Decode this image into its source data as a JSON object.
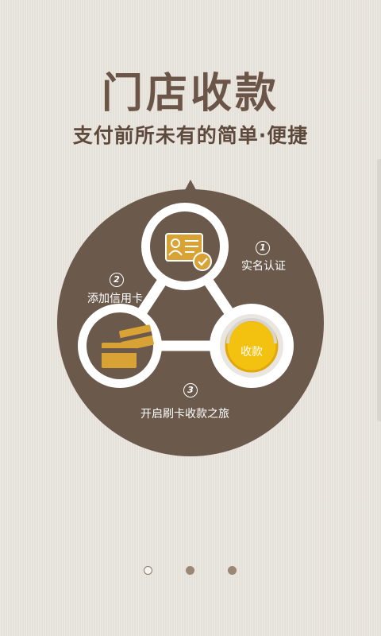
{
  "header": {
    "title": "门店收款",
    "subtitle": "支付前所未有的简单·便捷"
  },
  "steps": [
    {
      "number": "1",
      "label": "实名认证",
      "icon": "id-card-icon"
    },
    {
      "number": "2",
      "label": "添加信用卡",
      "icon": "credit-cards-icon"
    },
    {
      "number": "3",
      "label": "开启刷卡收款之旅",
      "icon": "payment-coin-icon"
    }
  ],
  "pay_button": {
    "label": "收款"
  },
  "pager": {
    "total": 3,
    "current": 1
  },
  "colors": {
    "background": "#e8e4dc",
    "bubble": "#6b5a4c",
    "title": "#6a5548",
    "gold": "#d9a235",
    "pay_yellow": "#f3c10f"
  }
}
